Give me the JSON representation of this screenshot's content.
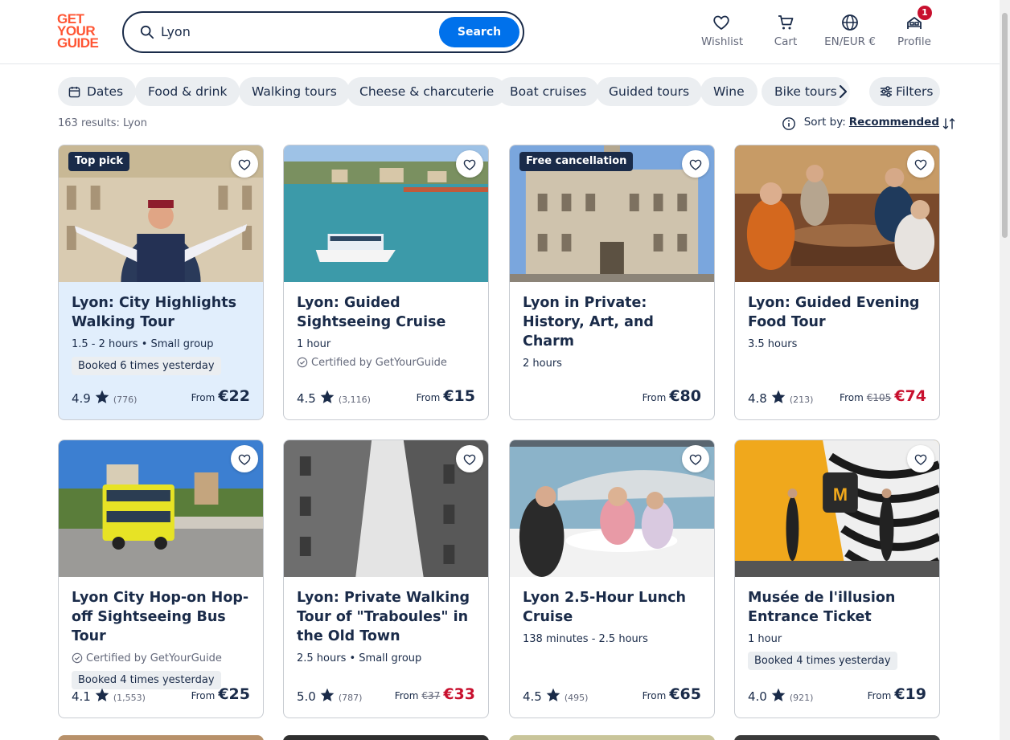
{
  "logo": {
    "line1": "GET",
    "line2": "YOUR",
    "line3": "GUIDE"
  },
  "search": {
    "value": "Lyon",
    "button_label": "Search"
  },
  "nav": {
    "wishlist": "Wishlist",
    "cart": "Cart",
    "language": "EN/EUR €",
    "profile": "Profile",
    "profile_badge": "1"
  },
  "chips": [
    "Dates",
    "Food & drink",
    "Walking tours",
    "Cheese & charcuterie",
    "Boat cruises",
    "Guided tours",
    "Wine",
    "Bike tours"
  ],
  "filters_label": "Filters",
  "results_text": "163 results: Lyon",
  "sort": {
    "label": "Sort by:",
    "value": "Recommended"
  },
  "cards": [
    {
      "title": "Lyon: City Highlights Walking Tour",
      "meta": "1.5 - 2 hours • Small group",
      "tag": "Top pick",
      "booked": "Booked 6 times yesterday",
      "rating": "4.9",
      "count": "(776)",
      "from": "From",
      "price": "€22"
    },
    {
      "title": "Lyon: Guided Sightseeing Cruise",
      "meta": "1 hour",
      "certified": "Certified by GetYourGuide",
      "rating": "4.5",
      "count": "(3,116)",
      "from": "From",
      "price": "€15"
    },
    {
      "title": "Lyon in Private: History, Art, and Charm",
      "meta": "2 hours",
      "tag": "Free cancellation",
      "from": "From",
      "price": "€80"
    },
    {
      "title": "Lyon: Guided Evening Food Tour",
      "meta": "3.5 hours",
      "rating": "4.8",
      "count": "(213)",
      "from": "From",
      "old_price": "€105",
      "price": "€74"
    },
    {
      "title": "Lyon City Hop-on Hop-off Sightseeing Bus Tour",
      "certified": "Certified by GetYourGuide",
      "booked": "Booked 4 times yesterday",
      "rating": "4.1",
      "count": "(1,553)",
      "from": "From",
      "price": "€25"
    },
    {
      "title": "Lyon: Private Walking Tour of \"Traboules\" in the Old Town",
      "meta": "2.5 hours • Small group",
      "rating": "5.0",
      "count": "(787)",
      "from": "From",
      "old_price": "€37",
      "price": "€33"
    },
    {
      "title": "Lyon 2.5-Hour Lunch Cruise",
      "meta": "138 minutes - 2.5 hours",
      "rating": "4.5",
      "count": "(495)",
      "from": "From",
      "price": "€65"
    },
    {
      "title": "Musée de l'illusion Entrance Ticket",
      "meta": "1 hour",
      "booked": "Booked 4 times yesterday",
      "rating": "4.0",
      "count": "(921)",
      "from": "From",
      "price": "€19"
    }
  ],
  "colors": {
    "brand": "#ff5533",
    "accent": "#0071eb",
    "text": "#1a2b49",
    "sale": "#c8102e",
    "highlight": "#e1eefc"
  }
}
